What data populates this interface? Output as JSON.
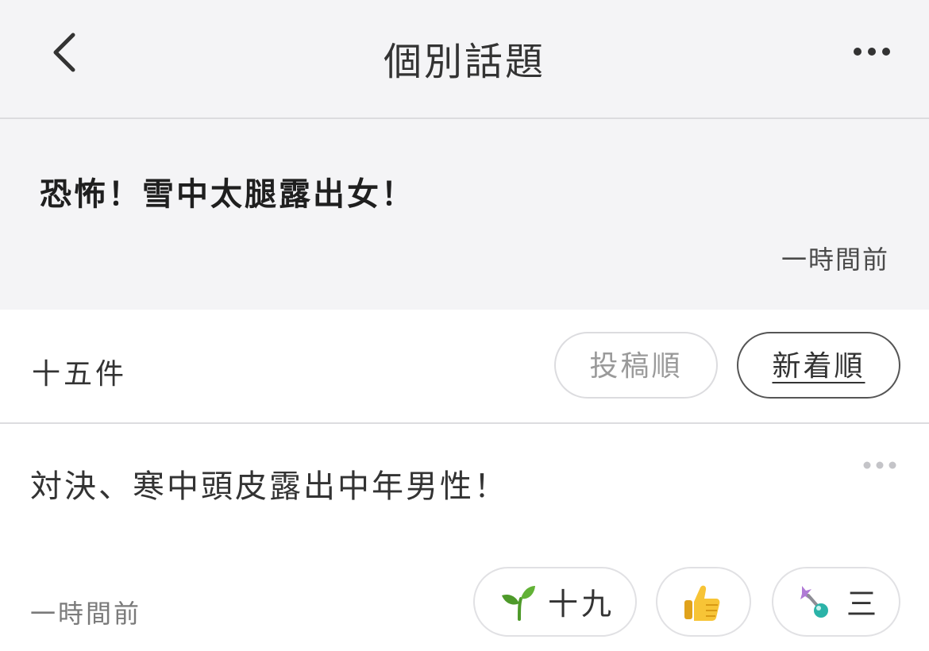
{
  "nav": {
    "title": "個別話題",
    "back_icon": "chevron-left-icon",
    "more_icon": "more-horizontal-icon"
  },
  "topic": {
    "title": "恐怖！雪中太腿露出女！",
    "time": "一時間前"
  },
  "list_header": {
    "count": "十五件",
    "sort_options": [
      {
        "label": "投稿順",
        "selected": false
      },
      {
        "label": "新着順",
        "selected": true
      }
    ]
  },
  "posts": [
    {
      "body": "対決、寒中頭皮露出中年男性！",
      "time": "一時間前",
      "reactions": [
        {
          "icon": "sprout-icon",
          "count": "十九"
        },
        {
          "icon": "thumbs-up-icon",
          "count": ""
        },
        {
          "icon": "sparkle-wand-icon",
          "count": "三"
        }
      ]
    }
  ],
  "colors": {
    "header_bg": "#f4f4f6",
    "divider": "#dcdcdf",
    "text": "#333333",
    "muted": "#9a9a9a"
  }
}
